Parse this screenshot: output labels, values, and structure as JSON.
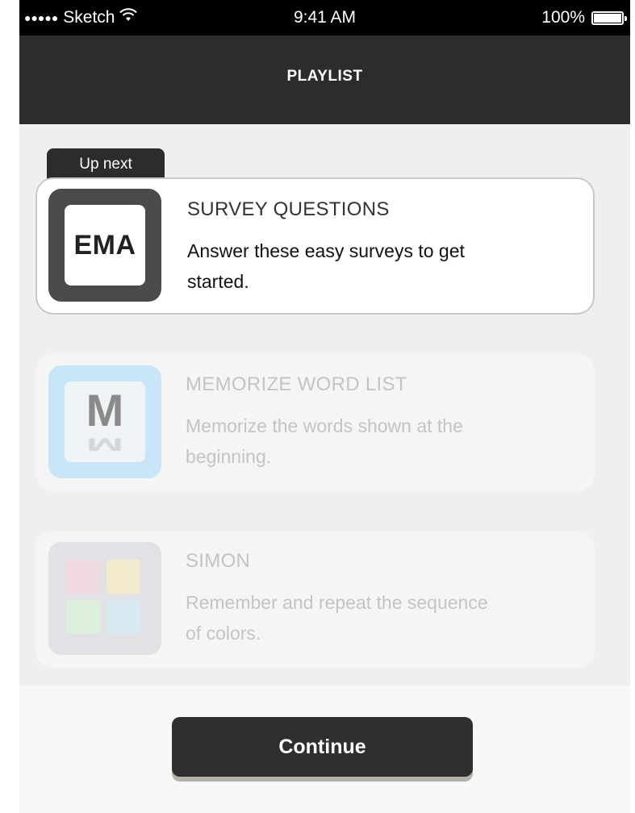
{
  "status_bar": {
    "carrier": "Sketch",
    "signal_dots": "●●●●●",
    "time": "9:41 AM",
    "battery": "100%"
  },
  "nav": {
    "title": "PLAYLIST"
  },
  "up_next_badge": "Up next",
  "playlist": [
    {
      "icon_text": "EMA",
      "title": "SURVEY QUESTIONS",
      "description": "Answer these easy surveys to get started."
    },
    {
      "icon_text": "M",
      "title": "MEMORIZE WORD LIST",
      "description": "Memorize the words shown at the beginning."
    },
    {
      "title": "SIMON",
      "description": "Remember and repeat the sequence of colors."
    }
  ],
  "continue_label": "Continue",
  "colors": {
    "nav_bg": "#2c2c2c",
    "list_bg": "#efeff0",
    "button_bg": "#2f2f2f",
    "m_tile": "#c8e6f7",
    "simon_pink": "#f1d9e1",
    "simon_yellow": "#f3ebce",
    "simon_green": "#dcefdc",
    "simon_blue": "#d7eaf2"
  }
}
